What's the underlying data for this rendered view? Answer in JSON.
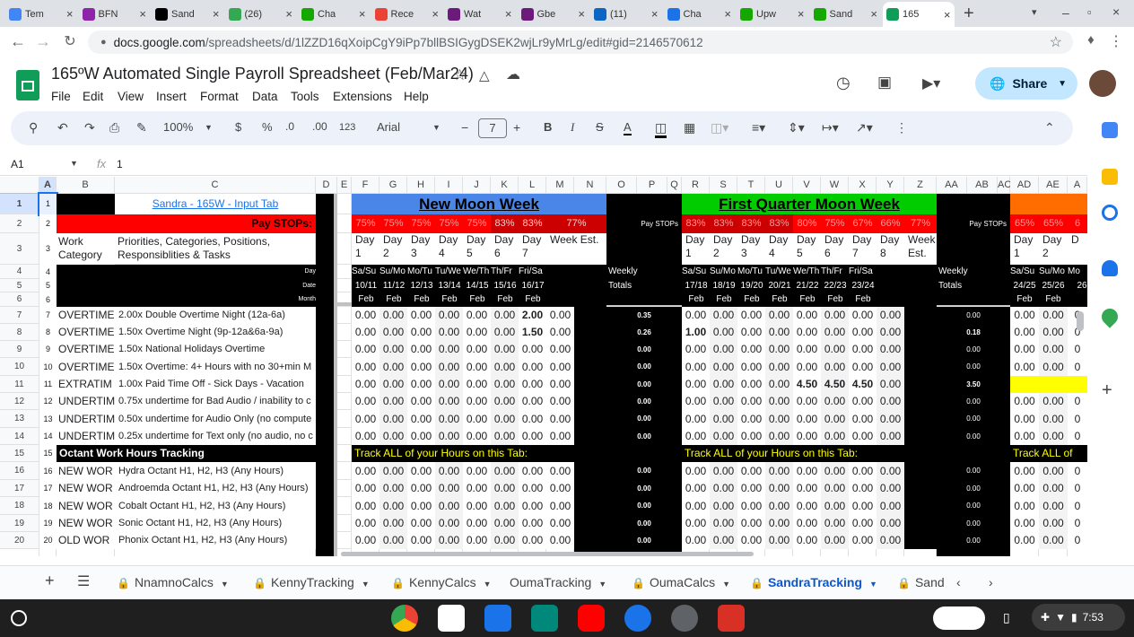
{
  "browser": {
    "tabs": [
      {
        "label": "Tem",
        "color": "#4285f4"
      },
      {
        "label": "BFN",
        "color": "#8e24aa"
      },
      {
        "label": "Sand",
        "color": "#000000"
      },
      {
        "label": "(26)",
        "color": "#34a853"
      },
      {
        "label": "Cha",
        "color": "#14a800"
      },
      {
        "label": "Rece",
        "color": "#ea4335"
      },
      {
        "label": "Wat",
        "color": "#6d1b7b"
      },
      {
        "label": "Gbe",
        "color": "#6d1b7b"
      },
      {
        "label": "(11)",
        "color": "#0a66c2"
      },
      {
        "label": "Cha",
        "color": "#1a73e8"
      },
      {
        "label": "Upw",
        "color": "#14a800"
      },
      {
        "label": "Sand",
        "color": "#14a800"
      },
      {
        "label": "165",
        "color": "#0f9d58"
      }
    ],
    "new_tab": "+",
    "url_host": "docs.google.com",
    "url_path": "/spreadsheets/d/1lZZD16qXoipCgY9iPp7bllBSIGygDSEK2wjLr9yMrLg/edit#gid=2146570612"
  },
  "doc": {
    "title": "165ºW Automated Single Payroll Spreadsheet (Feb/Mar24)",
    "menus": [
      "File",
      "Edit",
      "View",
      "Insert",
      "Format",
      "Data",
      "Tools",
      "Extensions",
      "Help"
    ],
    "share_label": "Share"
  },
  "toolbar": {
    "zoom": "100%",
    "currency": "$",
    "percent": "%",
    "dec_less": ".0",
    "dec_more": ".00",
    "number_format": "123",
    "font": "Arial",
    "font_size": "7",
    "bold": "B",
    "italic": "I",
    "strike": "S",
    "text_color": "A"
  },
  "formula_bar": {
    "cell_ref": "A1",
    "fx": "fx",
    "value": "1"
  },
  "grid": {
    "columns": [
      "A",
      "B",
      "C",
      "D",
      "E",
      "F",
      "G",
      "H",
      "I",
      "J",
      "K",
      "L",
      "M",
      "N",
      "O",
      "P",
      "Q",
      "R",
      "S",
      "T",
      "U",
      "V",
      "W",
      "X",
      "Y",
      "Z",
      "AA",
      "AB",
      "AC",
      "AD",
      "AE",
      "A"
    ],
    "row_numbers": [
      "1",
      "2",
      "3",
      "4",
      "5",
      "6",
      "7",
      "8",
      "9",
      "10",
      "11",
      "12",
      "13",
      "14",
      "15",
      "16",
      "17",
      "18",
      "19",
      "20"
    ],
    "a_col": [
      "1",
      "2",
      "3",
      "4",
      "5",
      "6",
      "7",
      "8",
      "9",
      "10",
      "11",
      "12",
      "13",
      "14",
      "15",
      "16",
      "17",
      "18",
      "19",
      "20"
    ],
    "input_link": "Sandra - 165W - Input Tab",
    "pay_stops_label": "Pay STOPs:",
    "pay_stops_small": "Pay STOPs",
    "work_category": "Work Category",
    "priorities": "Priorities, Categories, Positions, Responsiblities & Tasks",
    "row4_label": "Day",
    "row5_label": "Date",
    "row6_label": "Month",
    "new_moon_title": "New Moon Week",
    "first_quarter_title": "First Quarter Moon Week",
    "new_moon_stops": [
      "75%",
      "75%",
      "75%",
      "75%",
      "75%",
      "83%",
      "83%",
      "77%"
    ],
    "first_quarter_stops": [
      "83%",
      "83%",
      "83%",
      "83%",
      "80%",
      "75%",
      "67%",
      "66%",
      "77%"
    ],
    "third_stops": [
      "65%",
      "65%",
      "6"
    ],
    "day_headers": [
      "Day 1",
      "Day 2",
      "Day 3",
      "Day 4",
      "Day 5",
      "Day 6",
      "Day 7",
      "Day 8"
    ],
    "week_est": "Week Est.",
    "day_headers_third": [
      "Day 1",
      "Day 2",
      "D"
    ],
    "new_moon_days": [
      "Sa/Su",
      "Su/Mo",
      "Mo/Tu",
      "Tu/We",
      "We/Th",
      "Th/Fr",
      "Fri/Sa"
    ],
    "new_moon_dates": [
      "10/11",
      "11/12",
      "12/13",
      "13/14",
      "14/15",
      "15/16",
      "16/17"
    ],
    "first_quarter_days": [
      "Sa/Su",
      "Su/Mo",
      "Mo/Tu",
      "Tu/We",
      "We/Th",
      "Th/Fr",
      "Fri/Sa"
    ],
    "first_quarter_dates": [
      "17/18",
      "18/19",
      "19/20",
      "20/21",
      "21/22",
      "22/23",
      "23/24"
    ],
    "third_days": [
      "Sa/Su",
      "Su/Mo",
      "Mo"
    ],
    "third_dates": [
      "24/25",
      "25/26",
      "26"
    ],
    "month": "Feb",
    "weekly": "Weekly",
    "totals": "Totals",
    "track_banner": "Track ALL of your Hours on this Tab:",
    "track_banner_short": "Track ALL of",
    "octant_header": "Octant Work Hours Tracking",
    "rows": [
      {
        "b": "OVERTIME",
        "c": "2.00x Double Overtime Night (12a-6a)",
        "nm": [
          "0.00",
          "0.00",
          "0.00",
          "0.00",
          "0.00",
          "0.00",
          "2.00",
          "0.00"
        ],
        "nmtot": "0.35",
        "fq": [
          "0.00",
          "0.00",
          "0.00",
          "0.00",
          "0.00",
          "0.00",
          "0.00",
          "0.00"
        ],
        "fqtot": "0.00",
        "th": [
          "0.00",
          "0.00",
          "0"
        ]
      },
      {
        "b": "OVERTIME",
        "c": "1.50x Overtime Night (9p-12a&6a-9a)",
        "nm": [
          "0.00",
          "0.00",
          "0.00",
          "0.00",
          "0.00",
          "0.00",
          "1.50",
          "0.00"
        ],
        "nmtot": "0.26",
        "fq": [
          "1.00",
          "0.00",
          "0.00",
          "0.00",
          "0.00",
          "0.00",
          "0.00",
          "0.00"
        ],
        "fqtot": "0.18",
        "th": [
          "0.00",
          "0.00",
          "0"
        ]
      },
      {
        "b": "OVERTIME",
        "c": "1.50x National Holidays Overtime",
        "nm": [
          "0.00",
          "0.00",
          "0.00",
          "0.00",
          "0.00",
          "0.00",
          "0.00",
          "0.00"
        ],
        "nmtot": "0.00",
        "fq": [
          "0.00",
          "0.00",
          "0.00",
          "0.00",
          "0.00",
          "0.00",
          "0.00",
          "0.00"
        ],
        "fqtot": "0.00",
        "th": [
          "0.00",
          "0.00",
          "0"
        ]
      },
      {
        "b": "OVERTIME",
        "c": "1.50x Overtime: 4+ Hours with no 30+min M",
        "nm": [
          "0.00",
          "0.00",
          "0.00",
          "0.00",
          "0.00",
          "0.00",
          "0.00",
          "0.00"
        ],
        "nmtot": "0.00",
        "fq": [
          "0.00",
          "0.00",
          "0.00",
          "0.00",
          "0.00",
          "0.00",
          "0.00",
          "0.00"
        ],
        "fqtot": "0.00",
        "th": [
          "0.00",
          "0.00",
          "0"
        ]
      },
      {
        "b": "EXTRATIM",
        "c": "1.00x Paid Time Off - Sick Days - Vacation",
        "nm": [
          "0.00",
          "0.00",
          "0.00",
          "0.00",
          "0.00",
          "0.00",
          "0.00",
          "0.00"
        ],
        "nmtot": "0.00",
        "fq": [
          "0.00",
          "0.00",
          "0.00",
          "0.00",
          "4.50",
          "4.50",
          "4.50",
          "0.00"
        ],
        "fqtot": "3.50",
        "th": [
          "",
          "",
          ""
        ]
      },
      {
        "b": "UNDERTIM",
        "c": "0.75x undertime for Bad Audio / inability to c",
        "nm": [
          "0.00",
          "0.00",
          "0.00",
          "0.00",
          "0.00",
          "0.00",
          "0.00",
          "0.00"
        ],
        "nmtot": "0.00",
        "fq": [
          "0.00",
          "0.00",
          "0.00",
          "0.00",
          "0.00",
          "0.00",
          "0.00",
          "0.00"
        ],
        "fqtot": "0.00",
        "th": [
          "0.00",
          "0.00",
          "0"
        ]
      },
      {
        "b": "UNDERTIM",
        "c": "0.50x undertime for Audio Only (no compute",
        "nm": [
          "0.00",
          "0.00",
          "0.00",
          "0.00",
          "0.00",
          "0.00",
          "0.00",
          "0.00"
        ],
        "nmtot": "0.00",
        "fq": [
          "0.00",
          "0.00",
          "0.00",
          "0.00",
          "0.00",
          "0.00",
          "0.00",
          "0.00"
        ],
        "fqtot": "0.00",
        "th": [
          "0.00",
          "0.00",
          "0"
        ]
      },
      {
        "b": "UNDERTIM",
        "c": "0.25x undertime for Text only (no audio, no c",
        "nm": [
          "0.00",
          "0.00",
          "0.00",
          "0.00",
          "0.00",
          "0.00",
          "0.00",
          "0.00"
        ],
        "nmtot": "0.00",
        "fq": [
          "0.00",
          "0.00",
          "0.00",
          "0.00",
          "0.00",
          "0.00",
          "0.00",
          "0.00"
        ],
        "fqtot": "0.00",
        "th": [
          "0.00",
          "0.00",
          "0"
        ]
      },
      {
        "b": "",
        "c": "",
        "nm": [],
        "nmtot": "",
        "fq": [],
        "fqtot": "",
        "th": []
      },
      {
        "b": "NEW WOR",
        "c": "Hydra Octant H1, H2, H3 (Any Hours)",
        "nm": [
          "0.00",
          "0.00",
          "0.00",
          "0.00",
          "0.00",
          "0.00",
          "0.00",
          "0.00"
        ],
        "nmtot": "0.00",
        "fq": [
          "0.00",
          "0.00",
          "0.00",
          "0.00",
          "0.00",
          "0.00",
          "0.00",
          "0.00"
        ],
        "fqtot": "0.00",
        "th": [
          "0.00",
          "0.00",
          "0"
        ]
      },
      {
        "b": "NEW WOR",
        "c": "Androemda Octant H1, H2, H3  (Any Hours)",
        "nm": [
          "0.00",
          "0.00",
          "0.00",
          "0.00",
          "0.00",
          "0.00",
          "0.00",
          "0.00"
        ],
        "nmtot": "0.00",
        "fq": [
          "0.00",
          "0.00",
          "0.00",
          "0.00",
          "0.00",
          "0.00",
          "0.00",
          "0.00"
        ],
        "fqtot": "0.00",
        "th": [
          "0.00",
          "0.00",
          "0"
        ]
      },
      {
        "b": "NEW WOR",
        "c": "Cobalt Octant H1, H2, H3  (Any Hours)",
        "nm": [
          "0.00",
          "0.00",
          "0.00",
          "0.00",
          "0.00",
          "0.00",
          "0.00",
          "0.00"
        ],
        "nmtot": "0.00",
        "fq": [
          "0.00",
          "0.00",
          "0.00",
          "0.00",
          "0.00",
          "0.00",
          "0.00",
          "0.00"
        ],
        "fqtot": "0.00",
        "th": [
          "0.00",
          "0.00",
          "0"
        ]
      },
      {
        "b": "NEW WOR",
        "c": "Sonic Octant H1, H2, H3  (Any Hours)",
        "nm": [
          "0.00",
          "0.00",
          "0.00",
          "0.00",
          "0.00",
          "0.00",
          "0.00",
          "0.00"
        ],
        "nmtot": "0.00",
        "fq": [
          "0.00",
          "0.00",
          "0.00",
          "0.00",
          "0.00",
          "0.00",
          "0.00",
          "0.00"
        ],
        "fqtot": "0.00",
        "th": [
          "0.00",
          "0.00",
          "0"
        ]
      },
      {
        "b": "OLD WOR",
        "c": "Phonix Octant H1, H2, H3  (Any Hours)",
        "nm": [
          "0.00",
          "0.00",
          "0.00",
          "0.00",
          "0.00",
          "0.00",
          "0.00",
          "0.00"
        ],
        "nmtot": "0.00",
        "fq": [
          "0.00",
          "0.00",
          "0.00",
          "0.00",
          "0.00",
          "0.00",
          "0.00",
          "0.00"
        ],
        "fqtot": "0.00",
        "th": [
          "0.00",
          "0.00",
          "0"
        ]
      }
    ]
  },
  "sheets": {
    "tabs": [
      {
        "label": "NnamnoCalcs",
        "locked": true
      },
      {
        "label": "KennyTracking",
        "locked": true
      },
      {
        "label": "KennyCalcs",
        "locked": true
      },
      {
        "label": "OumaTracking",
        "locked": false
      },
      {
        "label": "OumaCalcs",
        "locked": true
      },
      {
        "label": "SandraTracking",
        "locked": true,
        "active": true
      },
      {
        "label": "Sand",
        "locked": true
      }
    ]
  },
  "shelf": {
    "time": "7:53"
  }
}
